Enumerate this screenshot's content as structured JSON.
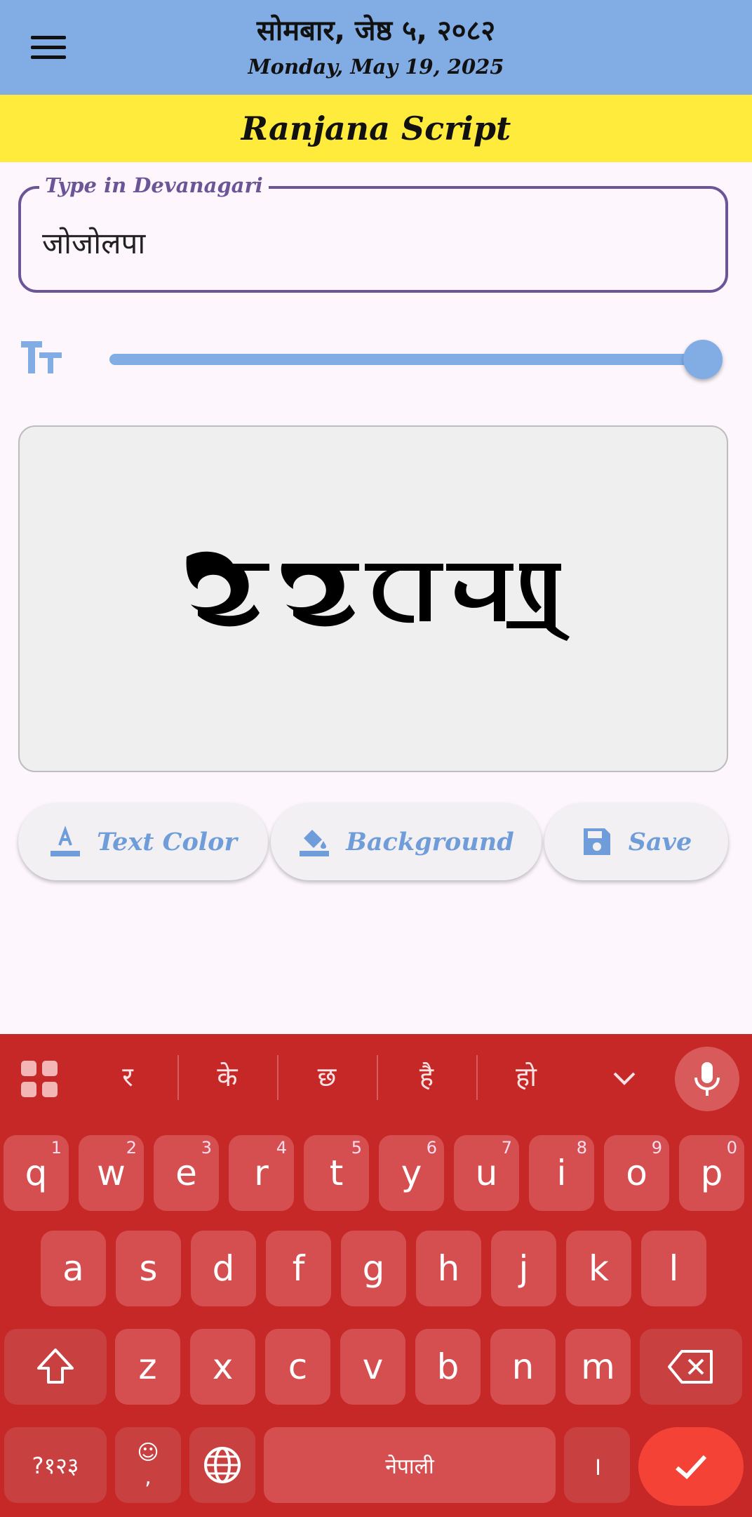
{
  "header": {
    "nepali_date": "सोमबार, जेष्ठ ५, २०८२",
    "english_date": "Monday, May 19, 2025",
    "title": "Ranjana Script",
    "bg_color": "#82ade4",
    "title_bg_color": "#ffeb3b",
    "menu_icon": "hamburger-menu-icon"
  },
  "input": {
    "label": "Type in Devanagari",
    "value": "जोजोलपा",
    "border_color": "#6b5596"
  },
  "font_size_slider": {
    "icon": "text-size-icon",
    "value_fraction": 1.0,
    "color": "#82ade4"
  },
  "preview": {
    "text_color": "#000000",
    "bg_color": "#efefef"
  },
  "actions": {
    "text_color_label": "Text Color",
    "background_label": "Background",
    "save_label": "Save",
    "accent": "#6f9dd9"
  },
  "keyboard": {
    "bg_color": "#c62828",
    "suggestions": [
      "र",
      "के",
      "छ",
      "है",
      "हो"
    ],
    "row1": [
      {
        "key": "q",
        "hint": "1"
      },
      {
        "key": "w",
        "hint": "2"
      },
      {
        "key": "e",
        "hint": "3"
      },
      {
        "key": "r",
        "hint": "4"
      },
      {
        "key": "t",
        "hint": "5"
      },
      {
        "key": "y",
        "hint": "6"
      },
      {
        "key": "u",
        "hint": "7"
      },
      {
        "key": "i",
        "hint": "8"
      },
      {
        "key": "o",
        "hint": "9"
      },
      {
        "key": "p",
        "hint": "0"
      }
    ],
    "row2": [
      "a",
      "s",
      "d",
      "f",
      "g",
      "h",
      "j",
      "k",
      "l"
    ],
    "row3": [
      "z",
      "x",
      "c",
      "v",
      "b",
      "n",
      "m"
    ],
    "symbols_label": "?१२३",
    "comma_label": ",",
    "space_label": "नेपाली",
    "danda_label": "।",
    "enter_color": "#f44336"
  }
}
